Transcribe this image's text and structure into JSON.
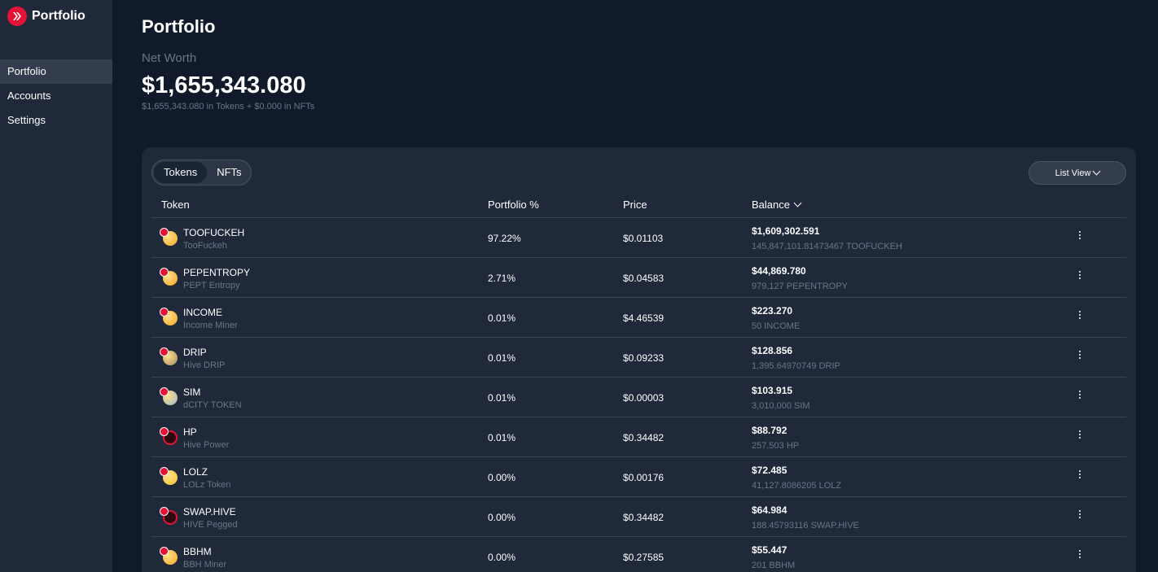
{
  "app": {
    "title": "Portfolio",
    "brand_color": "#e31337"
  },
  "sidebar": {
    "items": [
      {
        "label": "Portfolio",
        "active": true
      },
      {
        "label": "Accounts",
        "active": false
      },
      {
        "label": "Settings",
        "active": false
      }
    ]
  },
  "header": {
    "title": "Portfolio",
    "net_worth_label": "Net Worth",
    "net_worth_value": "$1,655,343.080",
    "breakdown": "$1,655,343.080 in Tokens + $0.000 in NFTs"
  },
  "tabs": [
    {
      "label": "Tokens",
      "active": true
    },
    {
      "label": "NFTs",
      "active": false
    }
  ],
  "view_button": {
    "label": "List View"
  },
  "table": {
    "columns": {
      "token": "Token",
      "pct": "Portfolio %",
      "price": "Price",
      "balance": "Balance"
    },
    "rows": [
      {
        "symbol": "TOOFUCKEH",
        "name": "TooFuckeh",
        "pct": "97.22%",
        "price": "$0.01103",
        "balance": "$1,609,302.591",
        "amount": "145,847,101.81473467 TOOFUCKEH",
        "icon": "orange-coin-icon",
        "color": "#f5a623"
      },
      {
        "symbol": "PEPENTROPY",
        "name": "PEPT Entropy",
        "pct": "2.71%",
        "price": "$0.04583",
        "balance": "$44,869.780",
        "amount": "979,127 PEPENTROPY",
        "icon": "orange-coin-icon",
        "color": "#f5a623"
      },
      {
        "symbol": "INCOME",
        "name": "Income Miner",
        "pct": "0.01%",
        "price": "$4.46539",
        "balance": "$223.270",
        "amount": "50 INCOME",
        "icon": "orange-coin-icon",
        "color": "#f5a623"
      },
      {
        "symbol": "DRIP",
        "name": "Hive DRIP",
        "pct": "0.01%",
        "price": "$0.09233",
        "balance": "$128.856",
        "amount": "1,395.64970749 DRIP",
        "icon": "drip-coin-icon",
        "color": "#a58b62"
      },
      {
        "symbol": "SIM",
        "name": "dCITY TOKEN",
        "pct": "0.01%",
        "price": "$0.00003",
        "balance": "$103.915",
        "amount": "3,010,000 SIM",
        "icon": "sim-coin-icon",
        "color": "#9fb3c8"
      },
      {
        "symbol": "HP",
        "name": "Hive Power",
        "pct": "0.01%",
        "price": "$0.34482",
        "balance": "$88.792",
        "amount": "257.503 HP",
        "icon": "hive-icon",
        "color": "#e31337"
      },
      {
        "symbol": "LOLZ",
        "name": "LOLz Token",
        "pct": "0.00%",
        "price": "$0.00176",
        "balance": "$72.485",
        "amount": "41,127.8086205 LOLZ",
        "icon": "lolz-coin-icon",
        "color": "#f4c430"
      },
      {
        "symbol": "SWAP.HIVE",
        "name": "HIVE Pegged",
        "pct": "0.00%",
        "price": "$0.34482",
        "balance": "$64.984",
        "amount": "188.45793116 SWAP.HIVE",
        "icon": "hive-icon",
        "color": "#e31337"
      },
      {
        "symbol": "BBHM",
        "name": "BBH Miner",
        "pct": "0.00%",
        "price": "$0.27585",
        "balance": "$55.447",
        "amount": "201 BBHM",
        "icon": "orange-coin-icon",
        "color": "#f5a623"
      }
    ]
  }
}
